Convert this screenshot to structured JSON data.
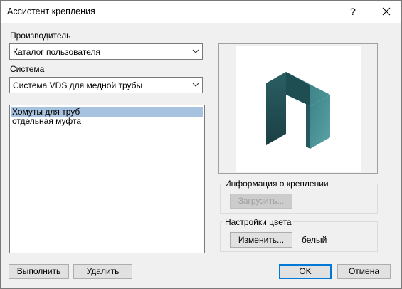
{
  "window": {
    "title": "Ассистент крепления",
    "help_label": "?"
  },
  "manufacturer": {
    "label": "Производитель",
    "selected": "Каталог пользователя"
  },
  "system": {
    "label": "Система",
    "selected": "Система VDS для медной трубы"
  },
  "list": {
    "items": [
      "Хомуты для труб",
      "отдельная муфта"
    ],
    "selected_index": 0
  },
  "info_group": {
    "label": "Информация о креплении",
    "load_label": "Загрузить..."
  },
  "color_group": {
    "label": "Настройки цвета",
    "change_label": "Изменить...",
    "color_value": "белый"
  },
  "buttons": {
    "execute": "Выполнить",
    "delete": "Удалить",
    "ok": "OK",
    "cancel": "Отмена"
  },
  "colors": {
    "logo_dark": "#1e4e52",
    "logo_mid": "#2f6e72",
    "logo_light": "#5aa3a6",
    "selection": "#a6c2de",
    "focus_border": "#0078d7"
  },
  "icons": {
    "close": "close-icon",
    "dropdown": "chevron-down-icon",
    "logo": "logo-icon"
  }
}
